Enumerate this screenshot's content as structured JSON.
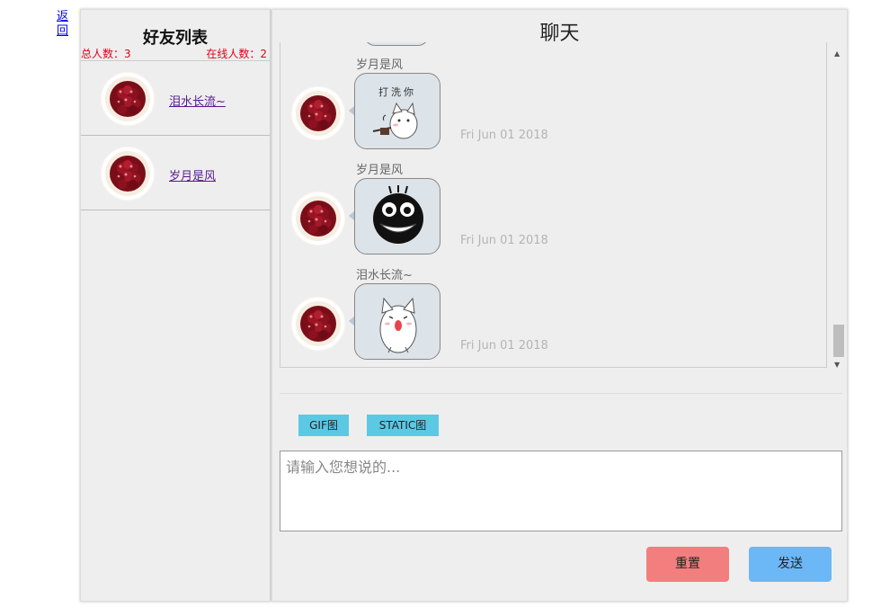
{
  "nav": {
    "back_label": "返回"
  },
  "friends": {
    "title": "好友列表",
    "total_label": "总人数：3",
    "online_label": "在线人数：2",
    "items": [
      {
        "name": "泪水长流~",
        "avatar": "cherries-avatar"
      },
      {
        "name": "岁月是风",
        "avatar": "cherries-avatar"
      }
    ]
  },
  "chat": {
    "title": "聊天",
    "messages": [
      {
        "sender": "岁月是风",
        "sticker": "cat-laundry-sticker",
        "sticker_text": "打洗你",
        "time": "Fri Jun 01 2018"
      },
      {
        "sender": "岁月是风",
        "sticker": "black-blob-grin-sticker",
        "time": "Fri Jun 01 2018"
      },
      {
        "sender": "泪水长流~",
        "sticker": "white-cat-cry-sticker",
        "time": "Fri Jun 01 2018"
      }
    ],
    "sticker_buttons": {
      "gif": "GIF图",
      "static": "STATIC图"
    },
    "input": {
      "placeholder": "请输入您想说的...",
      "value": ""
    },
    "actions": {
      "reset": "重置",
      "send": "发送"
    }
  },
  "colors": {
    "panel_bg": "#eeeeee",
    "count_red": "#e0001a",
    "sticker_btn": "#5bc8e4",
    "reset": "#f27f7e",
    "send": "#6cb7f5",
    "time_text": "#b4b4b4"
  }
}
